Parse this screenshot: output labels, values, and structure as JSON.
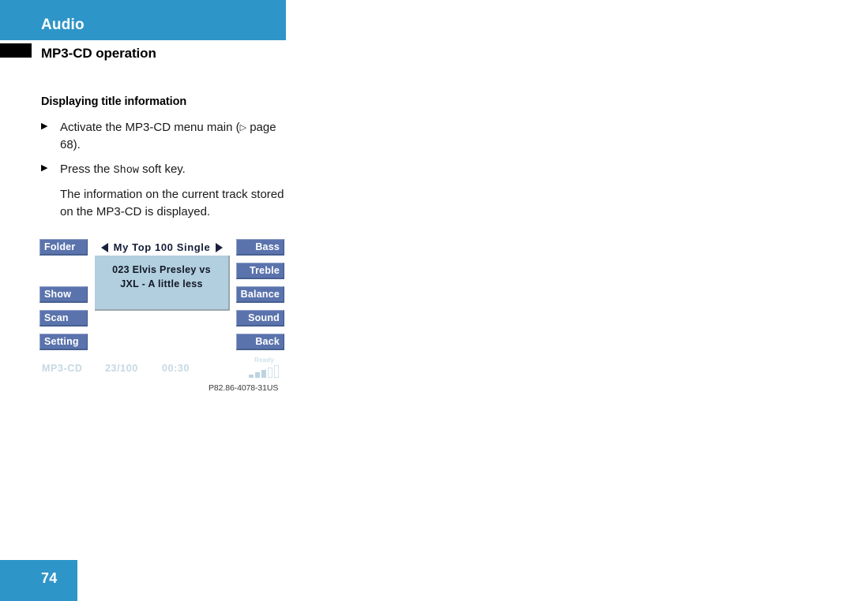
{
  "header": {
    "chapter": "Audio",
    "section": "MP3-CD operation"
  },
  "content": {
    "subhead": "Displaying title information",
    "steps": [
      {
        "marker": "▶",
        "text_before": "Activate the MP3-CD menu main (",
        "page_ref_arrow": "▷",
        "text_after": " page 68)."
      },
      {
        "marker": "▶",
        "text_before": "Press the ",
        "softkey_name": "Show",
        "text_after": " soft key."
      }
    ],
    "paragraph": "The information on the current track stored on the MP3-CD is displayed."
  },
  "display": {
    "left_keys": [
      {
        "label": "Folder"
      },
      {
        "label": "Show"
      },
      {
        "label": "Scan"
      },
      {
        "label": "Setting"
      }
    ],
    "right_keys": [
      {
        "label": "Bass"
      },
      {
        "label": "Treble"
      },
      {
        "label": "Balance"
      },
      {
        "label": "Sound"
      },
      {
        "label": "Back"
      }
    ],
    "title_row": {
      "prev_icon": "triangle-left-icon",
      "label": "My Top 100 Single",
      "next_icon": "triangle-right-icon"
    },
    "track_panel": {
      "line1": "023 Elvis Presley vs",
      "line2": "JXL - A little less"
    },
    "status": {
      "source": "MP3-CD",
      "track": "23/100",
      "time": "00:30",
      "signal_label": "Ready",
      "signal_bars_filled": 3,
      "signal_bars_total": 5
    }
  },
  "figure_caption": "P82.86-4078-31US",
  "footer": {
    "page_number": "74"
  },
  "colors": {
    "brand_blue": "#2E95C8",
    "softkey_blue": "#5B73AD",
    "panel_blue": "#B2CFDF",
    "status_text": "#C5D9E3"
  }
}
